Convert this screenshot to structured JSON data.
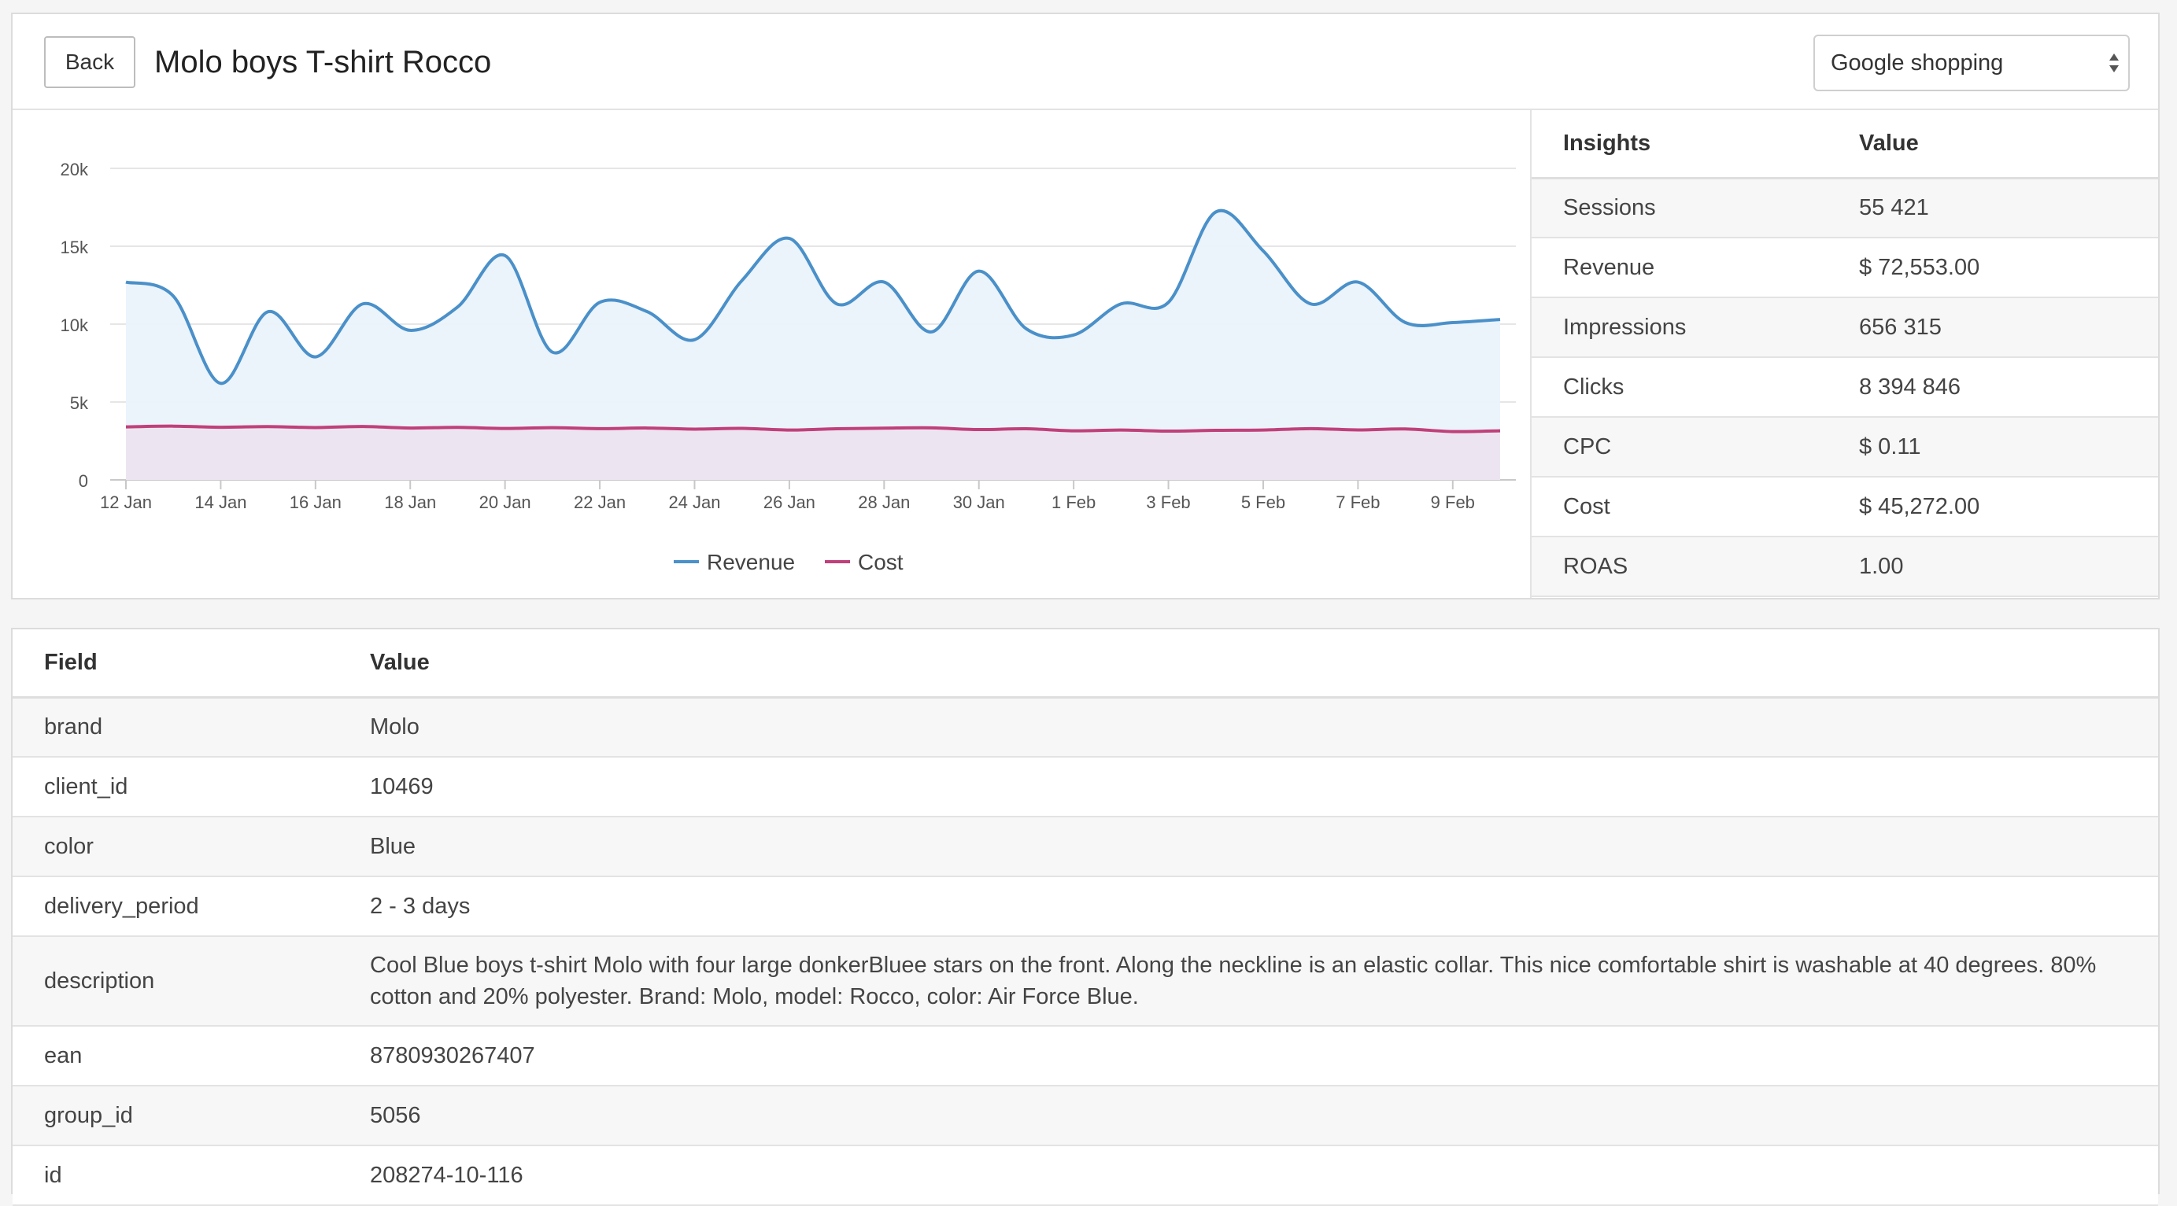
{
  "header": {
    "back_label": "Back",
    "title": "Molo boys T-shirt Rocco",
    "channel_selected": "Google shopping"
  },
  "colors": {
    "revenue": "#4a90c9",
    "revenue_fill": "#eaf2fb",
    "cost": "#c0407a",
    "cost_fill": "#ece4f0"
  },
  "chart_data": {
    "type": "area",
    "x": [
      "12 Jan",
      "13 Jan",
      "14 Jan",
      "15 Jan",
      "16 Jan",
      "17 Jan",
      "18 Jan",
      "19 Jan",
      "20 Jan",
      "21 Jan",
      "22 Jan",
      "23 Jan",
      "24 Jan",
      "25 Jan",
      "26 Jan",
      "27 Jan",
      "28 Jan",
      "29 Jan",
      "30 Jan",
      "31 Jan",
      "1 Feb",
      "2 Feb",
      "3 Feb",
      "4 Feb",
      "5 Feb",
      "6 Feb",
      "7 Feb",
      "8 Feb",
      "9 Feb",
      "10 Feb"
    ],
    "x_ticks": [
      "12 Jan",
      "14 Jan",
      "16 Jan",
      "18 Jan",
      "20 Jan",
      "22 Jan",
      "24 Jan",
      "26 Jan",
      "28 Jan",
      "30 Jan",
      "1 Feb",
      "3 Feb",
      "5 Feb",
      "7 Feb",
      "9 Feb"
    ],
    "y_ticks": [
      0,
      5000,
      10000,
      15000,
      20000
    ],
    "y_tick_labels": [
      "0",
      "5k",
      "10k",
      "15k",
      "20k"
    ],
    "ylim": [
      0,
      20000
    ],
    "grid": true,
    "legend_position": "bottom",
    "series": [
      {
        "name": "Revenue",
        "values": [
          12700,
          11800,
          6200,
          10800,
          7900,
          11300,
          9600,
          11100,
          14400,
          8200,
          11400,
          10800,
          9000,
          12800,
          15500,
          11300,
          12700,
          9500,
          13400,
          9700,
          9300,
          11300,
          11400,
          17200,
          14700,
          11300,
          12700,
          10100,
          10100,
          10300
        ]
      },
      {
        "name": "Cost",
        "values": [
          3400,
          3450,
          3380,
          3420,
          3360,
          3430,
          3330,
          3370,
          3300,
          3350,
          3290,
          3330,
          3260,
          3310,
          3200,
          3280,
          3320,
          3340,
          3230,
          3280,
          3150,
          3200,
          3130,
          3180,
          3200,
          3290,
          3210,
          3270,
          3100,
          3150
        ]
      }
    ]
  },
  "insights": {
    "headers": [
      "Insights",
      "Value"
    ],
    "rows": [
      [
        "Sessions",
        "55 421"
      ],
      [
        "Revenue",
        "$ 72,553.00"
      ],
      [
        "Impressions",
        "656 315"
      ],
      [
        "Clicks",
        "8 394 846"
      ],
      [
        "CPC",
        "$ 0.11"
      ],
      [
        "Cost",
        "$ 45,272.00"
      ],
      [
        "ROAS",
        "1.00"
      ]
    ]
  },
  "fields": {
    "headers": [
      "Field",
      "Value"
    ],
    "rows": [
      [
        "brand",
        "Molo"
      ],
      [
        "client_id",
        "10469"
      ],
      [
        "color",
        "Blue"
      ],
      [
        "delivery_period",
        "2 - 3 days"
      ],
      [
        "description",
        "Cool Blue boys t-shirt Molo with four large donkerBluee stars on the front. Along the neckline is an elastic collar. This nice comfortable shirt is washable at 40 degrees. 80% cotton and 20% polyester. Brand: Molo, model: Rocco, color: Air Force Blue."
      ],
      [
        "ean",
        "8780930267407"
      ],
      [
        "group_id",
        "5056"
      ],
      [
        "id",
        "208274-10-116"
      ]
    ]
  }
}
